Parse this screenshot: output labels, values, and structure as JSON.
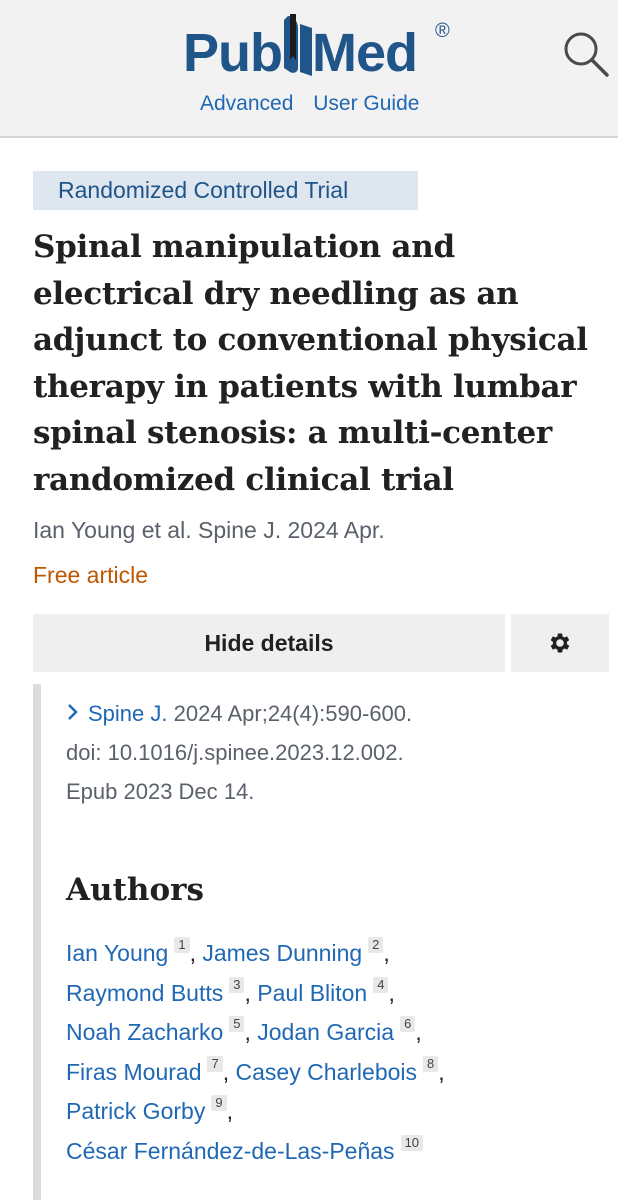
{
  "header": {
    "logo_left": "Pub",
    "logo_right": "Med",
    "logo_reg": "®",
    "links": [
      "Advanced",
      "User Guide"
    ],
    "search_icon": "search-icon"
  },
  "article": {
    "publication_type": "Randomized Controlled Trial",
    "title_lines": [
      "Spinal manipulation and",
      "electrical dry needling as an",
      "adjunct to conventional physical",
      "therapy in patients with lumbar",
      "spinal stenosis: a multi-center",
      "randomized clinical trial"
    ],
    "short_citation": "Ian Young et al. Spine J. 2024 Apr.",
    "free_label": "Free article"
  },
  "details": {
    "toggle_label": "Hide details",
    "settings_icon": "gear-icon",
    "journal_link": "Spine J.",
    "citation_line1": "2024 Apr;24(4):590-600.",
    "citation_line2": "doi: 10.1016/j.spinee.2023.12.002.",
    "citation_line3": "Epub 2023 Dec 14."
  },
  "authors_heading": "Authors",
  "authors": [
    {
      "name": "Ian Young",
      "aff": "1"
    },
    {
      "name": "James Dunning",
      "aff": "2"
    },
    {
      "name": "Raymond Butts",
      "aff": "3"
    },
    {
      "name": "Paul Bliton",
      "aff": "4"
    },
    {
      "name": "Noah Zacharko",
      "aff": "5"
    },
    {
      "name": "Jodan Garcia",
      "aff": "6"
    },
    {
      "name": "Firas Mourad",
      "aff": "7"
    },
    {
      "name": "Casey Charlebois",
      "aff": "8"
    },
    {
      "name": "Patrick Gorby",
      "aff": "9"
    },
    {
      "name": "César Fernández-de-Las-Peñas",
      "aff": "10"
    }
  ],
  "colors": {
    "brand": "#20558a",
    "link": "#2068b5",
    "free": "#bf5700"
  }
}
